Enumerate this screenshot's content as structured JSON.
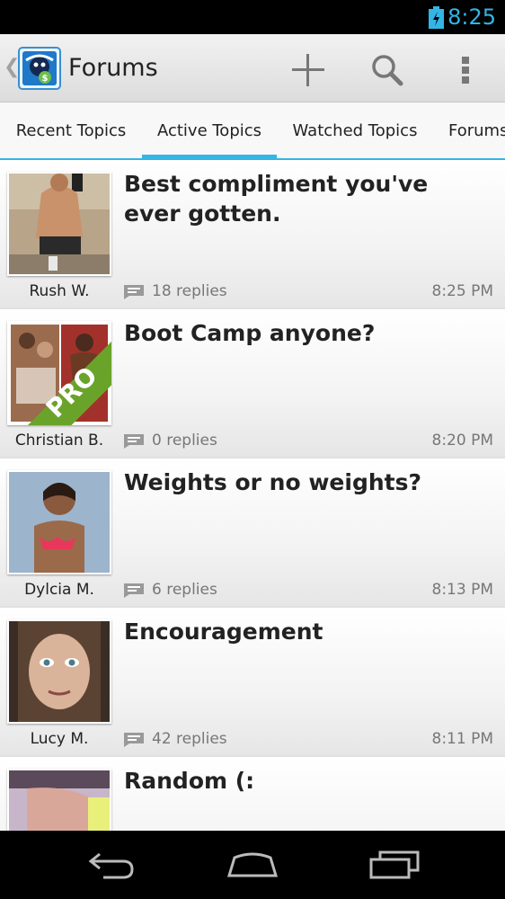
{
  "status_bar": {
    "time": "8:25",
    "accent_color": "#33b5e5"
  },
  "action_bar": {
    "title": "Forums",
    "up_icon": "chevron-left-icon",
    "logo_icon": "app-logo-icon",
    "actions": [
      {
        "name": "add-topic-button",
        "icon": "plus-icon"
      },
      {
        "name": "search-button",
        "icon": "search-icon"
      },
      {
        "name": "overflow-menu-button",
        "icon": "more-vert-icon"
      }
    ]
  },
  "tabs": [
    {
      "label": "Recent Topics",
      "active": false
    },
    {
      "label": "Active Topics",
      "active": true
    },
    {
      "label": "Watched Topics",
      "active": false
    },
    {
      "label": "Forums",
      "active": false
    }
  ],
  "topics": [
    {
      "title": "Best compliment you've ever gotten.",
      "author": "Rush W.",
      "replies": "18 replies",
      "time": "8:25 PM",
      "pro": false
    },
    {
      "title": "Boot Camp anyone?",
      "author": "Christian B.",
      "replies": "0 replies",
      "time": "8:20 PM",
      "pro": true,
      "pro_label": "PRO"
    },
    {
      "title": "Weights or no weights?",
      "author": "Dylcia M.",
      "replies": "6 replies",
      "time": "8:13 PM",
      "pro": false
    },
    {
      "title": "Encouragement",
      "author": "Lucy M.",
      "replies": "42 replies",
      "time": "8:11 PM",
      "pro": false
    },
    {
      "title": "Random (:",
      "author": "",
      "replies": "",
      "time": "",
      "pro": false
    }
  ],
  "nav_bar": {
    "buttons": [
      {
        "name": "back-button",
        "icon": "back-arrow-icon"
      },
      {
        "name": "home-button",
        "icon": "home-icon"
      },
      {
        "name": "recents-button",
        "icon": "recent-apps-icon"
      }
    ]
  }
}
